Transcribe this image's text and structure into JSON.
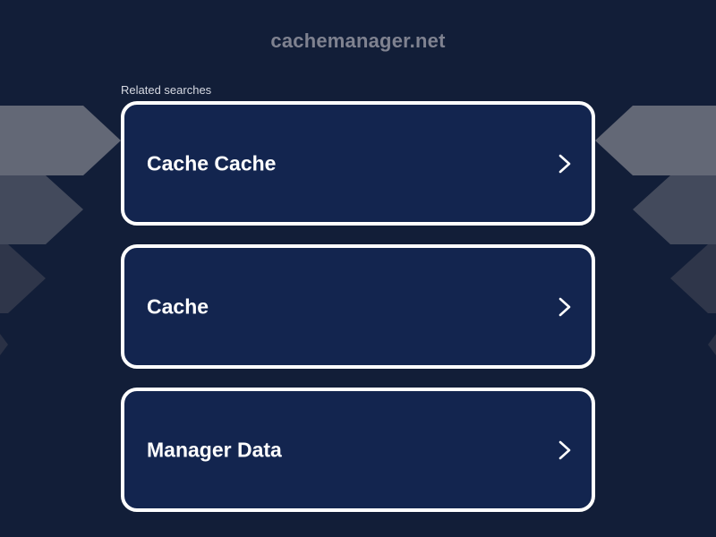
{
  "site": {
    "domain": "cachemanager.net"
  },
  "related": {
    "heading": "Related searches",
    "items": [
      {
        "label": "Cache Cache",
        "icon": "chevron-right-icon"
      },
      {
        "label": "Cache",
        "icon": "chevron-right-icon"
      },
      {
        "label": "Manager Data",
        "icon": "chevron-right-icon"
      }
    ]
  },
  "colors": {
    "background": "#121e38",
    "card": "#13254f",
    "card_border": "#ffffff",
    "title": "#7f8290"
  }
}
